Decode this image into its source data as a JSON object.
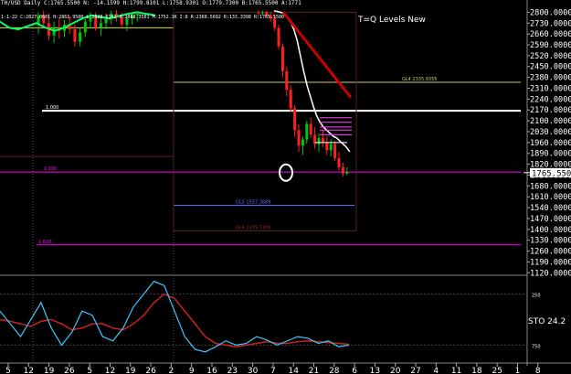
{
  "header": {
    "info": "TH/USD Daily  C:1765.5500  N: -14.1599  H:1799.8101  L:1758.9301  O:1779.7300  B:1765.5500  A:1771",
    "sub": "1-1-22  C:2827.0601  H:2861.9500  L:2828.6101  O:2868.3501  M:1752.1K  I:8  R:2368.5692  R:133.3398  R:1765.5500"
  },
  "title_overlay": "T=Q Levels New",
  "sto_label": "STO 24.2",
  "price_badge": "1765.5500",
  "colors": {
    "background": "#000000",
    "grid": "#333333",
    "up_candle": "#00c800",
    "down_candle": "#ff2020",
    "white_ma": "#ffffff",
    "red_trend": "#cc0000",
    "magenta_level": "#ff00ff",
    "sto_cyan": "#3cc8ff",
    "sto_red": "#cc2020"
  },
  "chart_data": {
    "type": "line",
    "y_axis_ticks": [
      "2800.0000",
      "2730.0000",
      "2660.0000",
      "2590.0000",
      "2520.0000",
      "2450.0000",
      "2380.0000",
      "2310.0000",
      "2240.0000",
      "2170.0000",
      "2100.0000",
      "2030.0000",
      "1960.0000",
      "1890.0000",
      "1820.0000",
      "1750.0000",
      "1680.0000",
      "1610.0000",
      "1540.0000",
      "1470.0000",
      "1400.0000",
      "1330.0000",
      "1260.0000",
      "1190.0000",
      "1120.0000"
    ],
    "ylim": [
      1110,
      2820
    ],
    "x_axis_ticks": [
      "5",
      "12",
      "19",
      "26",
      "5",
      "12",
      "19",
      "26",
      "2",
      "9",
      "16",
      "23",
      "30",
      "7",
      "14",
      "21",
      "28",
      "6",
      "13",
      "20",
      "27",
      "4",
      "11",
      "18",
      "25",
      "1",
      "8"
    ],
    "candles": [
      {
        "o": 2720,
        "h": 2800,
        "l": 2660,
        "c": 2780
      },
      {
        "o": 2780,
        "h": 2810,
        "l": 2700,
        "c": 2730
      },
      {
        "o": 2730,
        "h": 2790,
        "l": 2620,
        "c": 2650
      },
      {
        "o": 2650,
        "h": 2740,
        "l": 2600,
        "c": 2700
      },
      {
        "o": 2700,
        "h": 2760,
        "l": 2630,
        "c": 2680
      },
      {
        "o": 2680,
        "h": 2750,
        "l": 2640,
        "c": 2720
      },
      {
        "o": 2720,
        "h": 2780,
        "l": 2660,
        "c": 2690
      },
      {
        "o": 2690,
        "h": 2720,
        "l": 2580,
        "c": 2610
      },
      {
        "o": 2610,
        "h": 2700,
        "l": 2580,
        "c": 2670
      },
      {
        "o": 2670,
        "h": 2760,
        "l": 2640,
        "c": 2740
      },
      {
        "o": 2740,
        "h": 2800,
        "l": 2700,
        "c": 2770
      },
      {
        "o": 2770,
        "h": 2800,
        "l": 2680,
        "c": 2700
      },
      {
        "o": 2700,
        "h": 2760,
        "l": 2650,
        "c": 2730
      },
      {
        "o": 2730,
        "h": 2790,
        "l": 2690,
        "c": 2760
      },
      {
        "o": 2760,
        "h": 2810,
        "l": 2720,
        "c": 2790
      },
      {
        "o": 2790,
        "h": 2815,
        "l": 2740,
        "c": 2770
      },
      {
        "o": 2770,
        "h": 2800,
        "l": 2700,
        "c": 2720
      },
      {
        "o": 2720,
        "h": 2780,
        "l": 2680,
        "c": 2760
      },
      {
        "o": 2760,
        "h": 2800,
        "l": 2720,
        "c": 2780
      },
      {
        "o": 2780,
        "h": 2805,
        "l": 2740,
        "c": 2790
      },
      {
        "o": 2800,
        "h": 2812,
        "l": 2780,
        "c": 2795
      },
      {
        "o": 2795,
        "h": 2810,
        "l": 2780,
        "c": 2800
      },
      {
        "o": 2800,
        "h": 2810,
        "l": 2770,
        "c": 2780
      },
      {
        "o": 2780,
        "h": 2800,
        "l": 2740,
        "c": 2760
      },
      {
        "o": 2760,
        "h": 2780,
        "l": 2680,
        "c": 2700
      },
      {
        "o": 2700,
        "h": 2720,
        "l": 2560,
        "c": 2580
      },
      {
        "o": 2580,
        "h": 2600,
        "l": 2380,
        "c": 2420
      },
      {
        "o": 2420,
        "h": 2450,
        "l": 2260,
        "c": 2300
      },
      {
        "o": 2300,
        "h": 2330,
        "l": 2160,
        "c": 2180
      },
      {
        "o": 2180,
        "h": 2200,
        "l": 2000,
        "c": 2040
      },
      {
        "o": 2040,
        "h": 2080,
        "l": 1900,
        "c": 1940
      },
      {
        "o": 1940,
        "h": 2000,
        "l": 1880,
        "c": 1980
      },
      {
        "o": 1980,
        "h": 2100,
        "l": 1950,
        "c": 2080
      },
      {
        "o": 2080,
        "h": 2120,
        "l": 1990,
        "c": 2010
      },
      {
        "o": 2010,
        "h": 2060,
        "l": 1920,
        "c": 1950
      },
      {
        "o": 1950,
        "h": 2020,
        "l": 1900,
        "c": 1990
      },
      {
        "o": 1990,
        "h": 2040,
        "l": 1930,
        "c": 1960
      },
      {
        "o": 1960,
        "h": 2000,
        "l": 1880,
        "c": 1910
      },
      {
        "o": 1910,
        "h": 1980,
        "l": 1870,
        "c": 1950
      },
      {
        "o": 1950,
        "h": 1970,
        "l": 1840,
        "c": 1860
      },
      {
        "o": 1860,
        "h": 1900,
        "l": 1780,
        "c": 1800
      },
      {
        "o": 1800,
        "h": 1830,
        "l": 1740,
        "c": 1760
      },
      {
        "o": 1760,
        "h": 1800,
        "l": 1750,
        "c": 1770
      }
    ],
    "red_trendline": {
      "from_price": 2800,
      "to_price": 2250
    },
    "white_ma": [
      2810,
      2805,
      2800,
      2790,
      2770,
      2740,
      2690,
      2620,
      2520,
      2420,
      2330,
      2260,
      2190,
      2130,
      2090,
      2060,
      2040,
      2020,
      2000,
      1990,
      1970,
      1950,
      1930,
      1900
    ],
    "levels": [
      {
        "name": "white",
        "price": 2165,
        "label": "1.000",
        "color": "#ffffff"
      },
      {
        "name": "yellow",
        "price": 2348,
        "label": "GL4 2335.9355",
        "color": "#cccc66"
      },
      {
        "name": "magenta",
        "price": 1770,
        "label": "1.000",
        "color": "#ff00ff"
      },
      {
        "name": "blue",
        "price": 1555,
        "label": "GL5 1557.3889",
        "color": "#6666ff"
      },
      {
        "name": "magenta2",
        "price": 1300,
        "label": "1.618",
        "color": "#ff00ff"
      },
      {
        "name": "red_low",
        "price": 1390,
        "label": "GL6 1379.7300",
        "color": "#993333"
      }
    ],
    "sto_ticks": [
      "250",
      "750"
    ],
    "sto_cyan": [
      60,
      45,
      30,
      50,
      70,
      40,
      20,
      35,
      60,
      55,
      30,
      25,
      40,
      65,
      80,
      95,
      90,
      60,
      30,
      15,
      12,
      18,
      25,
      20,
      22,
      30,
      26,
      20,
      25,
      30,
      28,
      22,
      25,
      18,
      20
    ],
    "sto_red": [
      50,
      48,
      45,
      42,
      48,
      50,
      45,
      38,
      40,
      45,
      45,
      40,
      38,
      45,
      55,
      70,
      80,
      75,
      60,
      45,
      30,
      22,
      20,
      18,
      20,
      22,
      24,
      22,
      22,
      24,
      25,
      24,
      23,
      22,
      21
    ]
  }
}
